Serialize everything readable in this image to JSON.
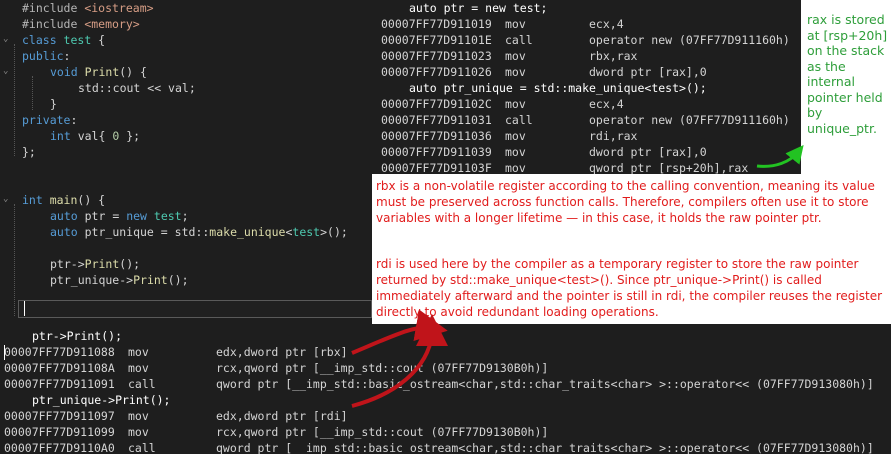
{
  "code": {
    "lines": [
      [
        "#include ",
        "<iostream>"
      ],
      [
        "#include ",
        "<memory>"
      ],
      [
        "class ",
        "test",
        " {"
      ],
      [
        "public",
        ":"
      ],
      [
        "void ",
        "Print",
        "() {"
      ],
      [
        "std",
        "::",
        "cout",
        " << ",
        "val",
        ";"
      ],
      [
        "}"
      ],
      [
        "private",
        ":"
      ],
      [
        "int ",
        "val",
        "{ ",
        "0",
        " };"
      ],
      [
        "};"
      ],
      [
        "int ",
        "main",
        "() {"
      ],
      [
        "auto ",
        "ptr",
        " = ",
        "new ",
        "test",
        ";"
      ],
      [
        "auto ",
        "ptr_unique",
        " = ",
        "std",
        "::",
        "make_unique",
        "<",
        "test",
        ">();"
      ],
      [
        "ptr",
        "->",
        "Print",
        "();"
      ],
      [
        "ptr_unique",
        "->",
        "Print",
        "();"
      ]
    ]
  },
  "asm_top": {
    "rows": [
      {
        "src": "auto ptr = new test;"
      },
      {
        "addr": "00007FF77D911019",
        "op": "mov",
        "arg": "ecx,4"
      },
      {
        "addr": "00007FF77D91101E",
        "op": "call",
        "arg": "operator new (07FF77D911160h)"
      },
      {
        "addr": "00007FF77D911023",
        "op": "mov",
        "arg": "rbx,rax"
      },
      {
        "addr": "00007FF77D911026",
        "op": "mov",
        "arg": "dword ptr [rax],0"
      },
      {
        "src": "auto ptr_unique = std::make_unique<test>();"
      },
      {
        "addr": "00007FF77D91102C",
        "op": "mov",
        "arg": "ecx,4"
      },
      {
        "addr": "00007FF77D911031",
        "op": "call",
        "arg": "operator new (07FF77D911160h)"
      },
      {
        "addr": "00007FF77D911036",
        "op": "mov",
        "arg": "rdi,rax"
      },
      {
        "addr": "00007FF77D911039",
        "op": "mov",
        "arg": "dword ptr [rax],0"
      },
      {
        "addr": "00007FF77D91103F",
        "op": "mov",
        "arg": "qword ptr [rsp+20h],rax"
      }
    ]
  },
  "asm_bottom": {
    "rows": [
      {
        "src": "ptr->Print();"
      },
      {
        "addr": "00007FF77D911088",
        "op": "mov",
        "arg": "edx,dword ptr [rbx]"
      },
      {
        "addr": "00007FF77D91108A",
        "op": "mov",
        "arg": "rcx,qword ptr [__imp_std::cout (07FF77D9130B0h)]"
      },
      {
        "addr": "00007FF77D911091",
        "op": "call",
        "arg": "qword ptr [__imp_std::basic_ostream<char,std::char_traits<char> >::operator<< (07FF77D913080h)]"
      },
      {
        "src": "ptr_unique->Print();"
      },
      {
        "addr": "00007FF77D911097",
        "op": "mov",
        "arg": "edx,dword ptr [rdi]"
      },
      {
        "addr": "00007FF77D911099",
        "op": "mov",
        "arg": "rcx,qword ptr [__imp_std::cout (07FF77D9130B0h)]"
      },
      {
        "addr": "00007FF77D9110A0",
        "op": "call",
        "arg": "qword ptr [__imp_std::basic_ostream<char,std::char_traits<char> >::operator<< (07FF77D913080h)]"
      }
    ]
  },
  "notes": {
    "green": "rax is stored at [rsp+20h] on the stack as the internal pointer held by unique_ptr.",
    "red_1": "rbx is a non-volatile register according to the calling convention, meaning its value must be preserved across function calls. Therefore, compilers often use it to store variables with a longer lifetime — in this case, it holds the raw pointer ptr.",
    "red_2": "rdi is used here by the compiler as a temporary register to store the raw pointer returned by std::make_unique<test>(). Since ptr_unique->Print() is called immediately afterward and the pointer is still in rdi, the compiler reuses the register directly to avoid redundant loading operations."
  },
  "colors": {
    "editor_bg": "#1e1e1e",
    "green_note": "#2e9e3a",
    "red_note": "#e11c1c",
    "arrow_red": "#c0141a",
    "arrow_green": "#22c322"
  }
}
